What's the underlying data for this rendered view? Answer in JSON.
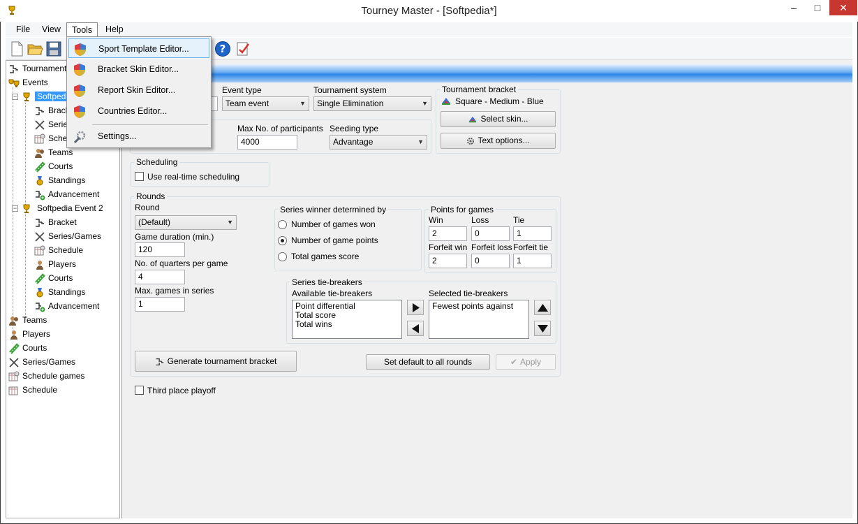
{
  "window": {
    "title": "Tourney Master - [Softpedia*]"
  },
  "menubar": {
    "file": "File",
    "view": "View",
    "tools": "Tools",
    "help": "Help"
  },
  "tools_menu": [
    {
      "label": "Sport Template Editor..."
    },
    {
      "label": "Bracket Skin Editor..."
    },
    {
      "label": "Report Skin Editor..."
    },
    {
      "label": "Countries Editor..."
    },
    {
      "label": "Settings..."
    }
  ],
  "tree": {
    "tournament": "Tournament",
    "events": "Events",
    "event1": {
      "label": "Softpedia",
      "children": [
        "Brack",
        "Serie",
        "Sche",
        "Teams",
        "Courts",
        "Standings",
        "Advancement"
      ]
    },
    "event2": {
      "label": "Softpedia Event 2",
      "children": [
        "Bracket",
        "Series/Games",
        "Schedule",
        "Players",
        "Courts",
        "Standings",
        "Advancement"
      ]
    },
    "root_items": [
      "Teams",
      "Players",
      "Courts",
      "Series/Games",
      "Schedule games",
      "Schedule"
    ]
  },
  "form": {
    "event_type": {
      "label": "Event type",
      "value": "Team event"
    },
    "tournament_system": {
      "label": "Tournament system",
      "value": "Single Elimination"
    },
    "max_participants": {
      "label": "Max No. of participants",
      "value": "4000"
    },
    "seeding_type": {
      "label": "Seeding type",
      "value": "Advantage"
    },
    "bracket": {
      "label": "Tournament bracket",
      "skin": "Square - Medium - Blue",
      "select_skin": "Select skin...",
      "text_options": "Text options..."
    },
    "scheduling": {
      "label": "Scheduling",
      "realtime": "Use real-time scheduling"
    },
    "rounds": {
      "label": "Rounds",
      "round_label": "Round",
      "round_value": "(Default)",
      "duration_label": "Game duration (min.)",
      "duration_value": "120",
      "quarters_label": "No. of quarters per game",
      "quarters_value": "4",
      "max_games_label": "Max. games in series",
      "max_games_value": "1"
    },
    "series_winner": {
      "label": "Series winner determined by",
      "options": [
        "Number of games won",
        "Number of game points",
        "Total games score"
      ],
      "selected": "Number of game points"
    },
    "points": {
      "label": "Points for games",
      "win_label": "Win",
      "win": "2",
      "loss_label": "Loss",
      "loss": "0",
      "tie_label": "Tie",
      "tie": "1",
      "fwin_label": "Forfeit win",
      "fwin": "2",
      "floss_label": "Forfeit loss",
      "floss": "0",
      "ftie_label": "Forfeit tie",
      "ftie": "1"
    },
    "tiebreakers": {
      "label": "Series tie-breakers",
      "available_label": "Available tie-breakers",
      "available": [
        "Point differential",
        "Total score",
        "Total wins"
      ],
      "selected_label": "Selected tie-breakers",
      "selected": [
        "Fewest points against"
      ]
    },
    "generate": "Generate tournament bracket",
    "set_default": "Set default to all rounds",
    "apply": "Apply",
    "third_place": "Third place playoff"
  },
  "colors": {
    "selection": "#3399ff",
    "close": "#c7372f",
    "header_bar": "#2d86e8"
  }
}
